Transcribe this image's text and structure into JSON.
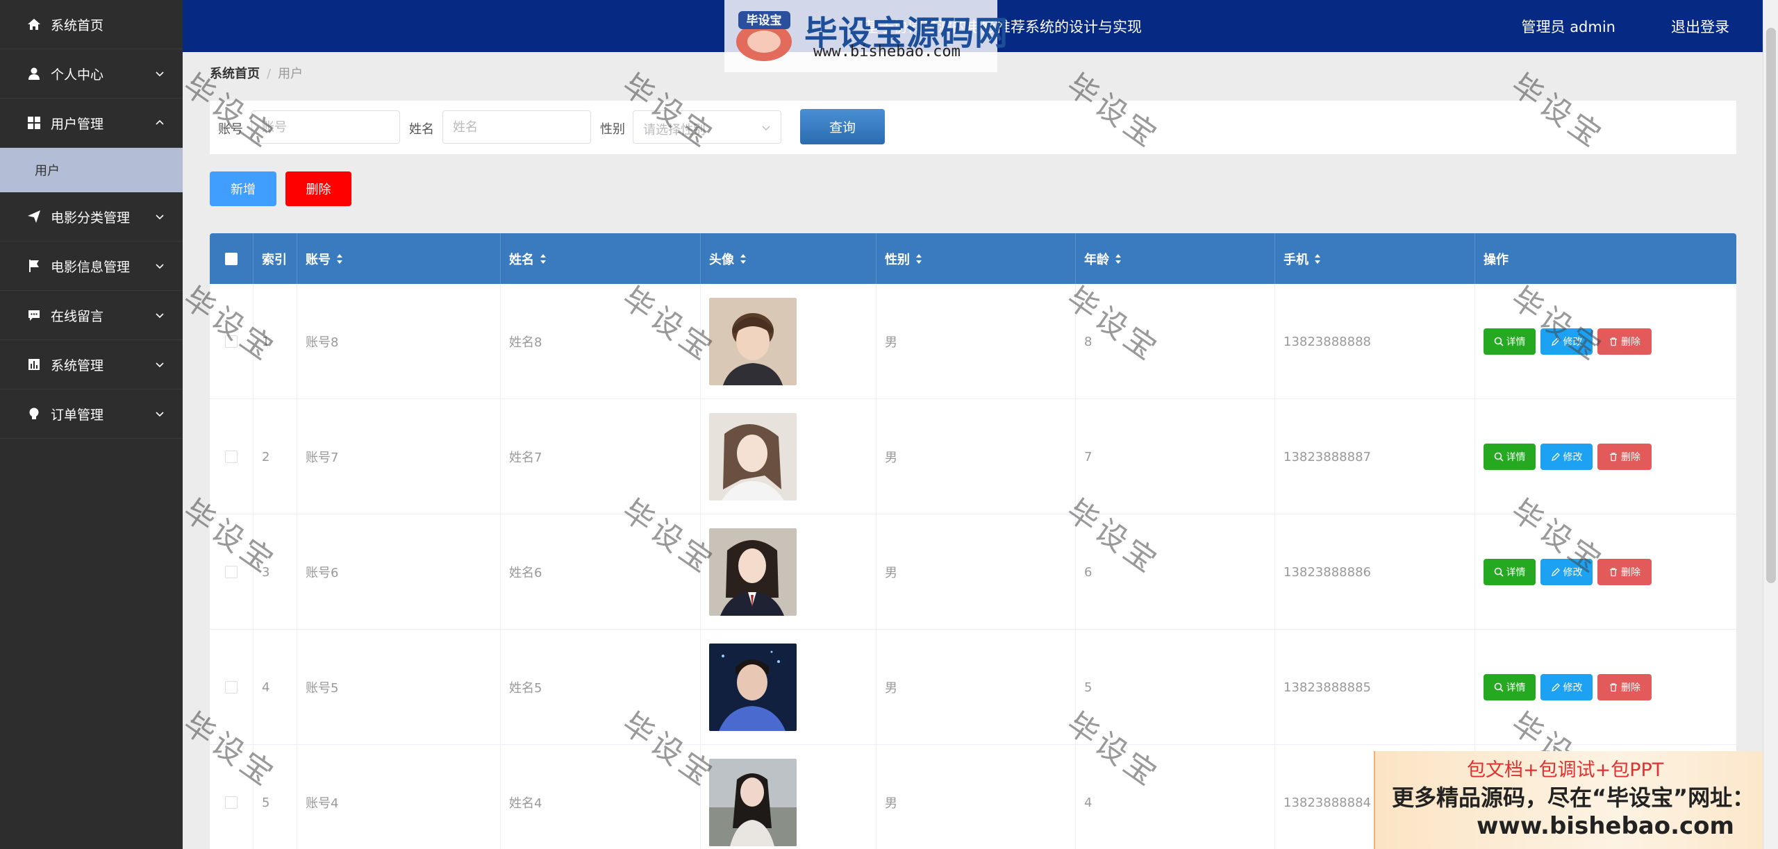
{
  "sidebar": {
    "items": [
      {
        "label": "系统首页",
        "icon": "home-icon"
      },
      {
        "label": "个人中心",
        "icon": "user-icon"
      },
      {
        "label": "用户管理",
        "icon": "grid-icon"
      },
      {
        "label": "用户",
        "sub": true
      },
      {
        "label": "电影分类管理",
        "icon": "send-icon"
      },
      {
        "label": "电影信息管理",
        "icon": "flag-icon"
      },
      {
        "label": "在线留言",
        "icon": "chat-icon"
      },
      {
        "label": "系统管理",
        "icon": "chart-icon"
      },
      {
        "label": "订单管理",
        "icon": "bulb-icon"
      }
    ]
  },
  "header": {
    "title": "基于协同过滤的电影推荐系统的设计与实现",
    "user": "管理员 admin",
    "logout": "退出登录"
  },
  "logo": {
    "badge": "毕设宝",
    "brand": "毕设宝源码网",
    "url": "www.bishebao.com"
  },
  "breadcrumb": {
    "home": "系统首页",
    "current": "用户"
  },
  "search": {
    "account_label": "账号",
    "account_placeholder": "账号",
    "name_label": "姓名",
    "name_placeholder": "姓名",
    "gender_label": "性别",
    "gender_placeholder": "请选择性别",
    "query_button": "查询"
  },
  "actions": {
    "add": "新增",
    "delete": "删除"
  },
  "table": {
    "headers": [
      "索引",
      "账号",
      "姓名",
      "头像",
      "性别",
      "年龄",
      "手机",
      "操作"
    ],
    "rows": [
      {
        "index": "1",
        "account": "账号8",
        "name": "姓名8",
        "gender": "男",
        "age": "8",
        "phone": "13823888888"
      },
      {
        "index": "2",
        "account": "账号7",
        "name": "姓名7",
        "gender": "男",
        "age": "7",
        "phone": "13823888887"
      },
      {
        "index": "3",
        "account": "账号6",
        "name": "姓名6",
        "gender": "男",
        "age": "6",
        "phone": "13823888886"
      },
      {
        "index": "4",
        "account": "账号5",
        "name": "姓名5",
        "gender": "男",
        "age": "5",
        "phone": "13823888885"
      },
      {
        "index": "5",
        "account": "账号4",
        "name": "姓名4",
        "gender": "男",
        "age": "4",
        "phone": "13823888884"
      }
    ],
    "ops": {
      "detail": "详情",
      "edit": "修改",
      "delete": "删除"
    }
  },
  "watermark": "毕设宝",
  "ad": {
    "line1": "包文档+包调试+包PPT",
    "line2": "更多精品源码，尽在“毕设宝”网址：",
    "line3": "www.bishebao.com"
  }
}
